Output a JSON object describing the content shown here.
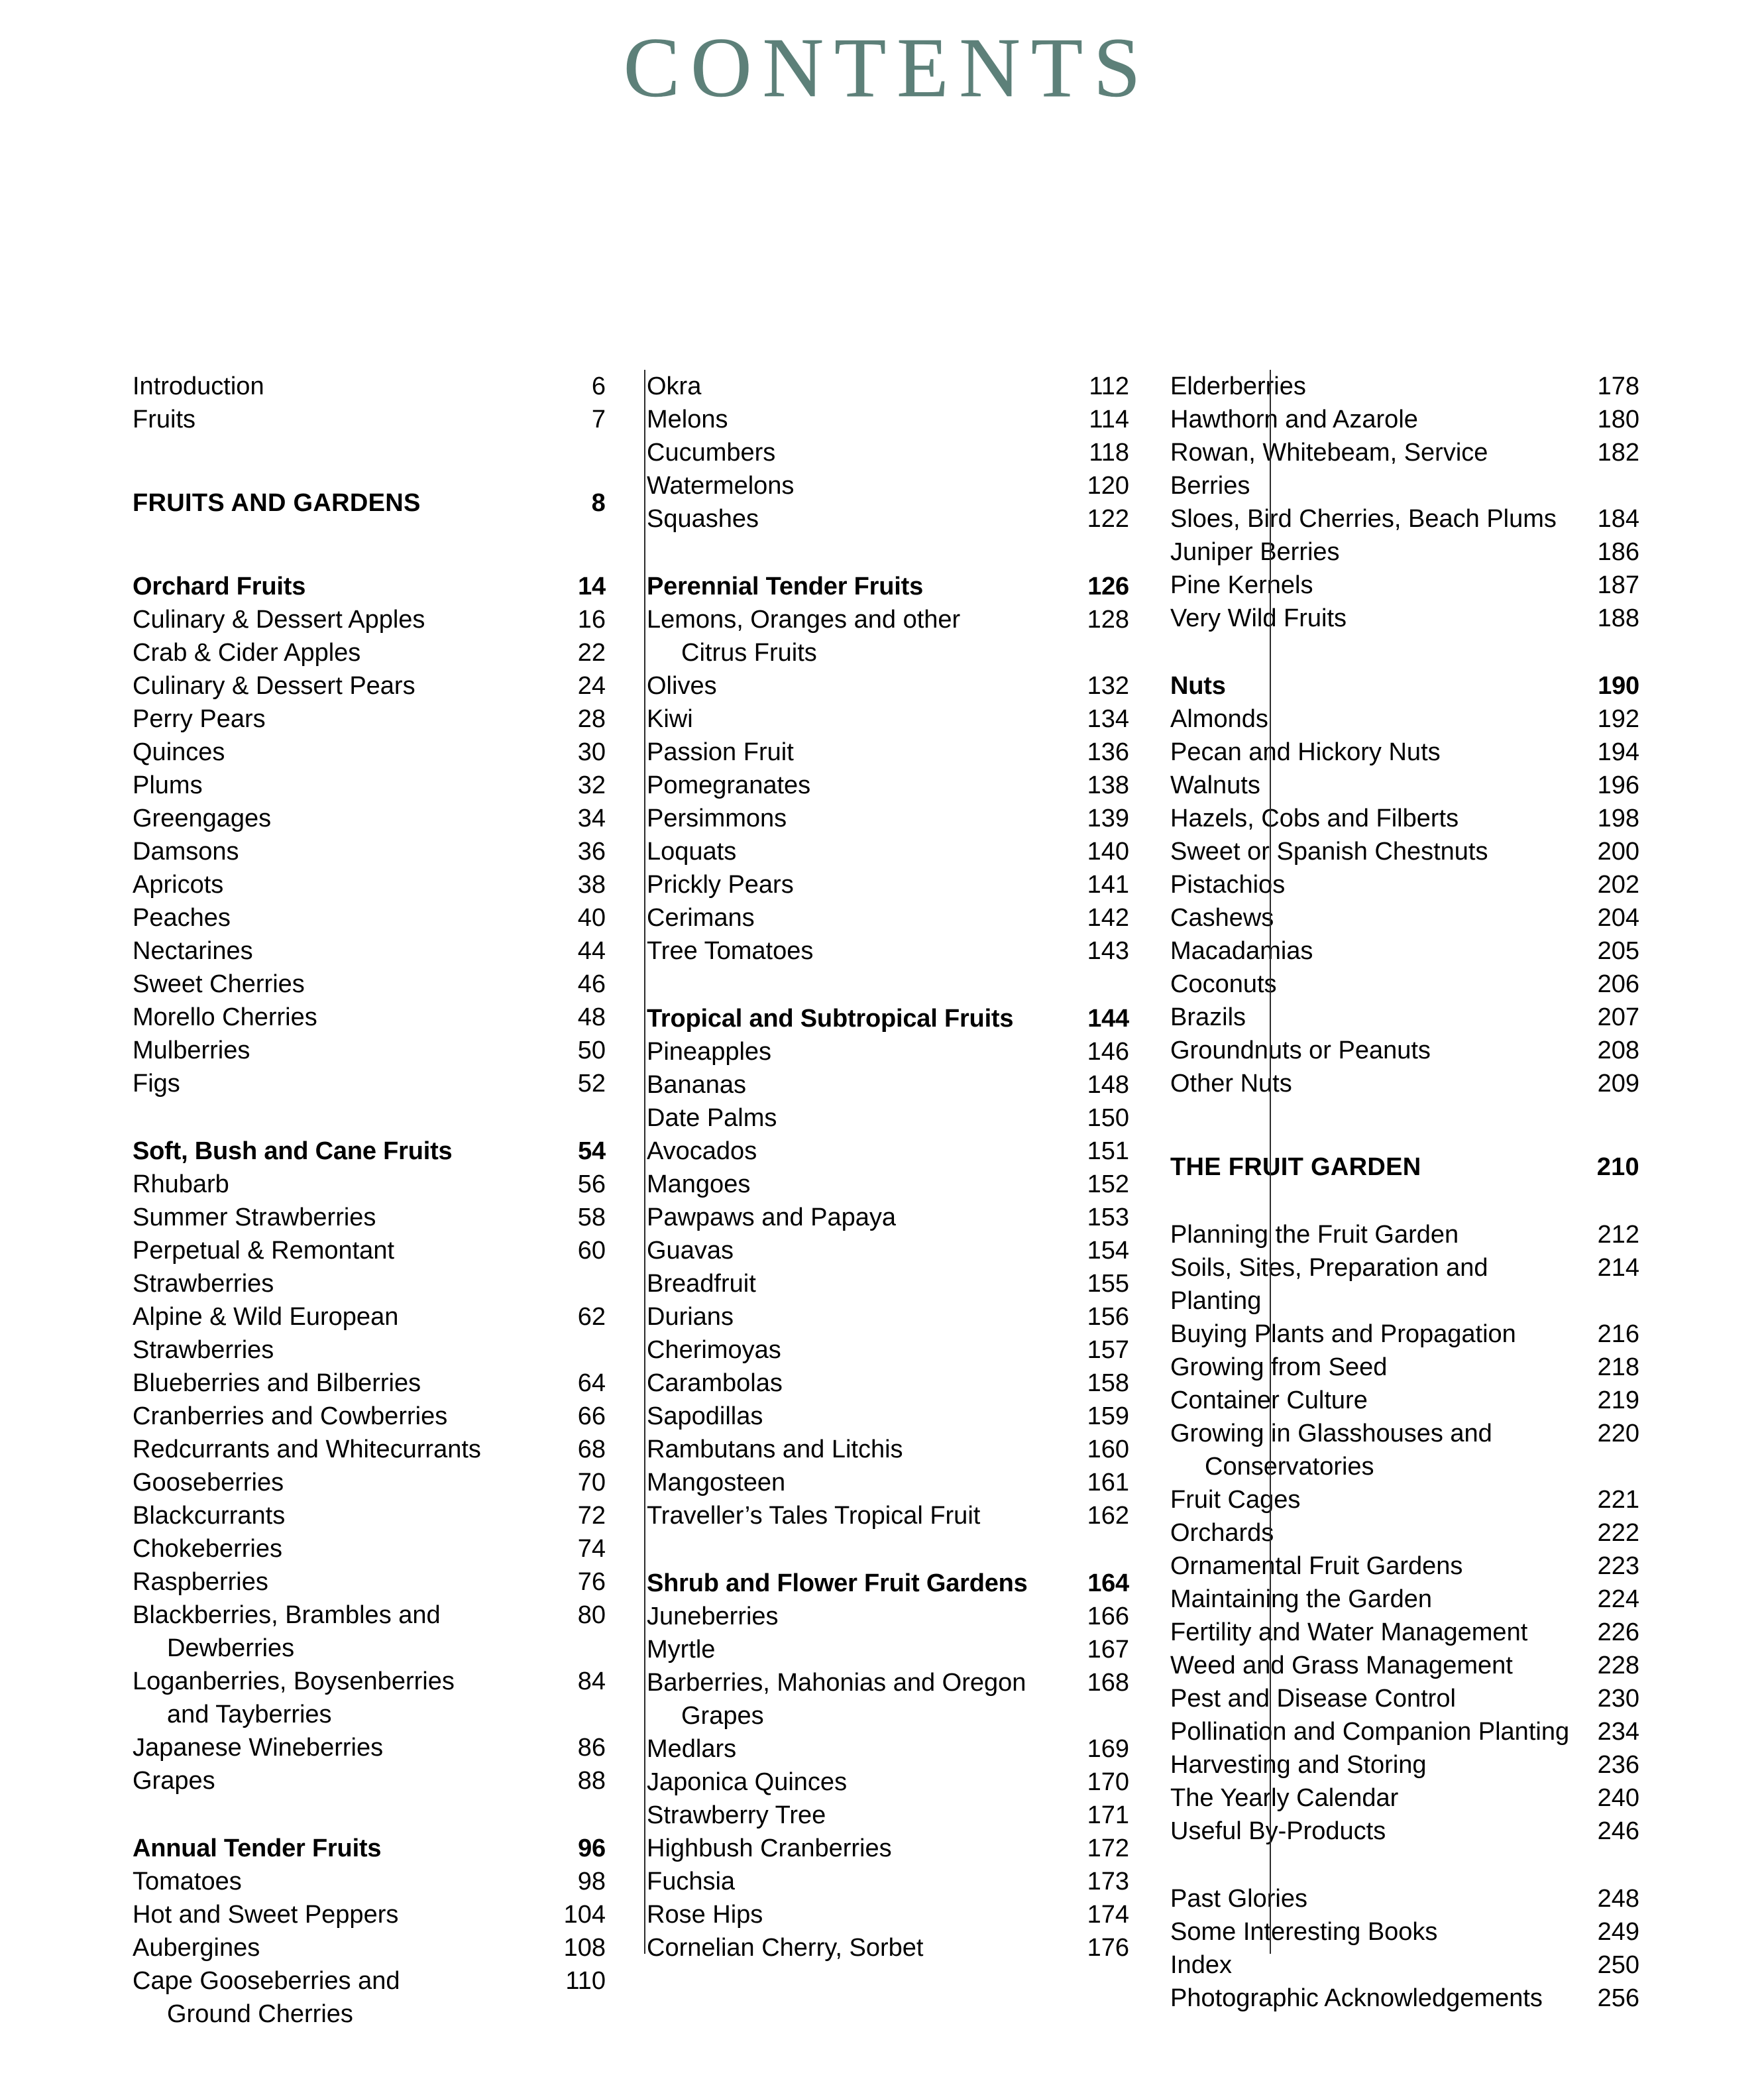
{
  "title": "CONTENTS",
  "accent_color": "#5d8079",
  "text_color": "#000000",
  "columns": [
    {
      "id": "column-1",
      "blocks": [
        {
          "type": "entry",
          "label": "Introduction",
          "page": "6"
        },
        {
          "type": "entry",
          "label": "Fruits",
          "page": "7"
        },
        {
          "type": "gap",
          "size": "lg"
        },
        {
          "type": "major",
          "label": "FRUITS AND GARDENS",
          "page": "8"
        },
        {
          "type": "gap",
          "size": "lg"
        },
        {
          "type": "section",
          "label": "Orchard Fruits",
          "page": "14"
        },
        {
          "type": "entry",
          "label": "Culinary & Dessert Apples",
          "page": "16"
        },
        {
          "type": "entry",
          "label": "Crab & Cider Apples",
          "page": "22"
        },
        {
          "type": "entry",
          "label": "Culinary & Dessert Pears",
          "page": "24"
        },
        {
          "type": "entry",
          "label": "Perry Pears",
          "page": "28"
        },
        {
          "type": "entry",
          "label": "Quinces",
          "page": "30"
        },
        {
          "type": "entry",
          "label": "Plums",
          "page": "32"
        },
        {
          "type": "entry",
          "label": "Greengages",
          "page": "34"
        },
        {
          "type": "entry",
          "label": "Damsons",
          "page": "36"
        },
        {
          "type": "entry",
          "label": "Apricots",
          "page": "38"
        },
        {
          "type": "entry",
          "label": "Peaches",
          "page": "40"
        },
        {
          "type": "entry",
          "label": "Nectarines",
          "page": "44"
        },
        {
          "type": "entry",
          "label": "Sweet Cherries",
          "page": "46"
        },
        {
          "type": "entry",
          "label": "Morello Cherries",
          "page": "48"
        },
        {
          "type": "entry",
          "label": "Mulberries",
          "page": "50"
        },
        {
          "type": "entry",
          "label": "Figs",
          "page": "52"
        },
        {
          "type": "gap",
          "size": "md"
        },
        {
          "type": "section",
          "label": "Soft, Bush and Cane Fruits",
          "page": "54"
        },
        {
          "type": "entry",
          "label": "Rhubarb",
          "page": "56"
        },
        {
          "type": "entry",
          "label": "Summer Strawberries",
          "page": "58"
        },
        {
          "type": "entry",
          "label": "Perpetual & Remontant Strawberries",
          "page": "60"
        },
        {
          "type": "entry",
          "label": "Alpine & Wild European Strawberries",
          "page": "62"
        },
        {
          "type": "entry",
          "label": "Blueberries and Bilberries",
          "page": "64"
        },
        {
          "type": "entry",
          "label": "Cranberries and Cowberries",
          "page": "66"
        },
        {
          "type": "entry",
          "label": "Redcurrants and Whitecurrants",
          "page": "68"
        },
        {
          "type": "entry",
          "label": "Gooseberries",
          "page": "70"
        },
        {
          "type": "entry",
          "label": "Blackcurrants",
          "page": "72"
        },
        {
          "type": "entry",
          "label": "Chokeberries",
          "page": "74"
        },
        {
          "type": "entry",
          "label": "Raspberries",
          "page": "76"
        },
        {
          "type": "entry",
          "label": "Blackberries, Brambles and",
          "page": "80"
        },
        {
          "type": "cont",
          "label": "Dewberries"
        },
        {
          "type": "entry",
          "label": "Loganberries, Boysenberries",
          "page": "84"
        },
        {
          "type": "cont",
          "label": "and Tayberries"
        },
        {
          "type": "entry",
          "label": "Japanese Wineberries",
          "page": "86"
        },
        {
          "type": "entry",
          "label": "Grapes",
          "page": "88"
        },
        {
          "type": "gap",
          "size": "md"
        },
        {
          "type": "section",
          "label": "Annual Tender Fruits",
          "page": "96"
        },
        {
          "type": "entry",
          "label": "Tomatoes",
          "page": "98"
        },
        {
          "type": "entry",
          "label": "Hot and Sweet Peppers",
          "page": "104"
        },
        {
          "type": "entry",
          "label": "Aubergines",
          "page": "108"
        },
        {
          "type": "entry",
          "label": "Cape Gooseberries and",
          "page": "110"
        },
        {
          "type": "cont",
          "label": "Ground Cherries"
        }
      ]
    },
    {
      "id": "column-2",
      "blocks": [
        {
          "type": "entry",
          "label": "Okra",
          "page": "112"
        },
        {
          "type": "entry",
          "label": "Melons",
          "page": "114"
        },
        {
          "type": "entry",
          "label": "Cucumbers",
          "page": "118"
        },
        {
          "type": "entry",
          "label": "Watermelons",
          "page": "120"
        },
        {
          "type": "entry",
          "label": "Squashes",
          "page": "122"
        },
        {
          "type": "gap",
          "size": "md"
        },
        {
          "type": "section",
          "label": "Perennial Tender Fruits",
          "page": "126"
        },
        {
          "type": "entry",
          "label": "Lemons, Oranges and other",
          "page": "128"
        },
        {
          "type": "cont",
          "label": "Citrus Fruits"
        },
        {
          "type": "entry",
          "label": "Olives",
          "page": "132"
        },
        {
          "type": "entry",
          "label": "Kiwi",
          "page": "134"
        },
        {
          "type": "entry",
          "label": "Passion Fruit",
          "page": "136"
        },
        {
          "type": "entry",
          "label": "Pomegranates",
          "page": "138"
        },
        {
          "type": "entry",
          "label": "Persimmons",
          "page": "139"
        },
        {
          "type": "entry",
          "label": "Loquats",
          "page": "140"
        },
        {
          "type": "entry",
          "label": "Prickly Pears",
          "page": "141"
        },
        {
          "type": "entry",
          "label": "Cerimans",
          "page": "142"
        },
        {
          "type": "entry",
          "label": "Tree Tomatoes",
          "page": "143"
        },
        {
          "type": "gap",
          "size": "md"
        },
        {
          "type": "section",
          "label": "Tropical and Subtropical Fruits",
          "page": "144"
        },
        {
          "type": "entry",
          "label": "Pineapples",
          "page": "146"
        },
        {
          "type": "entry",
          "label": "Bananas",
          "page": "148"
        },
        {
          "type": "entry",
          "label": "Date Palms",
          "page": "150"
        },
        {
          "type": "entry",
          "label": "Avocados",
          "page": "151"
        },
        {
          "type": "entry",
          "label": "Mangoes",
          "page": "152"
        },
        {
          "type": "entry",
          "label": "Pawpaws and Papaya",
          "page": "153"
        },
        {
          "type": "entry",
          "label": "Guavas",
          "page": "154"
        },
        {
          "type": "entry",
          "label": "Breadfruit",
          "page": "155"
        },
        {
          "type": "entry",
          "label": "Durians",
          "page": "156"
        },
        {
          "type": "entry",
          "label": "Cherimoyas",
          "page": "157"
        },
        {
          "type": "entry",
          "label": "Carambolas",
          "page": "158"
        },
        {
          "type": "entry",
          "label": "Sapodillas",
          "page": "159"
        },
        {
          "type": "entry",
          "label": "Rambutans and Litchis",
          "page": "160"
        },
        {
          "type": "entry",
          "label": "Mangosteen",
          "page": "161"
        },
        {
          "type": "entry",
          "label": "Traveller’s Tales Tropical Fruit",
          "page": "162"
        },
        {
          "type": "gap",
          "size": "md"
        },
        {
          "type": "section",
          "label": "Shrub and Flower Fruit Gardens",
          "page": "164"
        },
        {
          "type": "entry",
          "label": "Juneberries",
          "page": "166"
        },
        {
          "type": "entry",
          "label": "Myrtle",
          "page": "167"
        },
        {
          "type": "entry",
          "label": "Barberries, Mahonias and Oregon",
          "page": "168"
        },
        {
          "type": "cont",
          "label": "Grapes"
        },
        {
          "type": "entry",
          "label": "Medlars",
          "page": "169"
        },
        {
          "type": "entry",
          "label": "Japonica Quinces",
          "page": "170"
        },
        {
          "type": "entry",
          "label": "Strawberry Tree",
          "page": "171"
        },
        {
          "type": "entry",
          "label": "Highbush Cranberries",
          "page": "172"
        },
        {
          "type": "entry",
          "label": "Fuchsia",
          "page": "173"
        },
        {
          "type": "entry",
          "label": "Rose Hips",
          "page": "174"
        },
        {
          "type": "entry",
          "label": "Cornelian Cherry, Sorbet",
          "page": "176"
        }
      ]
    },
    {
      "id": "column-3",
      "blocks": [
        {
          "type": "entry",
          "label": "Elderberries",
          "page": "178"
        },
        {
          "type": "entry",
          "label": "Hawthorn and Azarole",
          "page": "180"
        },
        {
          "type": "entry",
          "label": "Rowan, Whitebeam, Service Berries",
          "page": "182"
        },
        {
          "type": "entry",
          "label": "Sloes, Bird Cherries, Beach Plums",
          "page": "184"
        },
        {
          "type": "entry",
          "label": "Juniper Berries",
          "page": "186"
        },
        {
          "type": "entry",
          "label": "Pine Kernels",
          "page": "187"
        },
        {
          "type": "entry",
          "label": "Very Wild Fruits",
          "page": "188"
        },
        {
          "type": "gap",
          "size": "md"
        },
        {
          "type": "section",
          "label": "Nuts",
          "page": "190"
        },
        {
          "type": "entry",
          "label": "Almonds",
          "page": "192"
        },
        {
          "type": "entry",
          "label": "Pecan and Hickory Nuts",
          "page": "194"
        },
        {
          "type": "entry",
          "label": "Walnuts",
          "page": "196"
        },
        {
          "type": "entry",
          "label": "Hazels, Cobs and Filberts",
          "page": "198"
        },
        {
          "type": "entry",
          "label": "Sweet or Spanish Chestnuts",
          "page": "200"
        },
        {
          "type": "entry",
          "label": "Pistachios",
          "page": "202"
        },
        {
          "type": "entry",
          "label": "Cashews",
          "page": "204"
        },
        {
          "type": "entry",
          "label": "Macadamias",
          "page": "205"
        },
        {
          "type": "entry",
          "label": "Coconuts",
          "page": "206"
        },
        {
          "type": "entry",
          "label": "Brazils",
          "page": "207"
        },
        {
          "type": "entry",
          "label": "Groundnuts or Peanuts",
          "page": "208"
        },
        {
          "type": "entry",
          "label": "Other Nuts",
          "page": "209"
        },
        {
          "type": "gap",
          "size": "lg"
        },
        {
          "type": "major",
          "label": "THE FRUIT GARDEN",
          "page": "210"
        },
        {
          "type": "gap",
          "size": "md"
        },
        {
          "type": "entry",
          "label": "Planning the Fruit Garden",
          "page": "212"
        },
        {
          "type": "entry",
          "label": "Soils, Sites, Preparation and Planting",
          "page": "214"
        },
        {
          "type": "entry",
          "label": "Buying Plants and Propagation",
          "page": "216"
        },
        {
          "type": "entry",
          "label": "Growing from Seed",
          "page": "218"
        },
        {
          "type": "entry",
          "label": "Container Culture",
          "page": "219"
        },
        {
          "type": "entry",
          "label": "Growing in Glasshouses and",
          "page": "220"
        },
        {
          "type": "cont",
          "label": "Conservatories"
        },
        {
          "type": "entry",
          "label": "Fruit Cages",
          "page": "221"
        },
        {
          "type": "entry",
          "label": "Orchards",
          "page": "222"
        },
        {
          "type": "entry",
          "label": "Ornamental Fruit Gardens",
          "page": "223"
        },
        {
          "type": "entry",
          "label": "Maintaining the Garden",
          "page": "224"
        },
        {
          "type": "entry",
          "label": "Fertility and Water Management",
          "page": "226"
        },
        {
          "type": "entry",
          "label": "Weed and Grass Management",
          "page": "228"
        },
        {
          "type": "entry",
          "label": "Pest and Disease Control",
          "page": "230"
        },
        {
          "type": "entry",
          "label": "Pollination and Companion Planting",
          "page": "234"
        },
        {
          "type": "entry",
          "label": "Harvesting and Storing",
          "page": "236"
        },
        {
          "type": "entry",
          "label": "The Yearly Calendar",
          "page": "240"
        },
        {
          "type": "entry",
          "label": "Useful By-Products",
          "page": "246"
        },
        {
          "type": "gap",
          "size": "md"
        },
        {
          "type": "entry",
          "label": "Past Glories",
          "page": "248"
        },
        {
          "type": "entry",
          "label": "Some Interesting Books",
          "page": "249"
        },
        {
          "type": "entry",
          "label": "Index",
          "page": "250"
        },
        {
          "type": "entry",
          "label": "Photographic Acknowledgements",
          "page": "256"
        }
      ]
    }
  ]
}
